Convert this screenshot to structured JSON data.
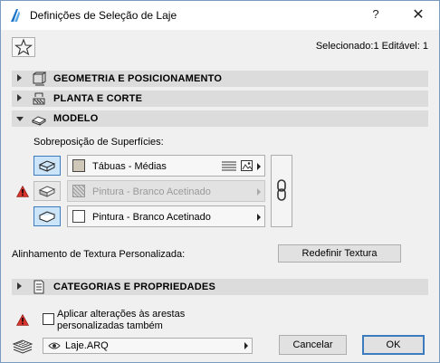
{
  "window": {
    "title": "Definições de Seleção de Laje",
    "help_label": "?",
    "close_label": "✕"
  },
  "header": {
    "selection_info": "Selecionado:1 Editável: 1"
  },
  "sections": {
    "geometry": "GEOMETRIA E POSICIONAMENTO",
    "plan": "PLANTA E CORTE",
    "model": "MODELO",
    "categories": "CATEGORIAS E PROPRIEDADES"
  },
  "model": {
    "surface_override_label": "Sobreposição de Superfícies:",
    "surfaces": [
      {
        "name": "Tábuas - Médias",
        "swatch_color": "#cfc8b8",
        "enabled": true
      },
      {
        "name": "Pintura - Branco Acetinado",
        "swatch_color": "#d6d6d6",
        "enabled": false
      },
      {
        "name": "Pintura - Branco Acetinado",
        "swatch_color": "#ffffff",
        "enabled": true
      }
    ],
    "texture_align_label": "Alinhamento de Textura Personalizada:",
    "reset_texture_label": "Redefinir Textura"
  },
  "footer": {
    "apply_label_line1": "Aplicar alterações às arestas",
    "apply_label_line2": "personalizadas também",
    "layer_name": "Laje.ARQ",
    "cancel_label": "Cancelar",
    "ok_label": "OK"
  },
  "colors": {
    "accent": "#3d7bbf",
    "warning": "#d9342b",
    "section_bg": "#dcdcdc"
  }
}
